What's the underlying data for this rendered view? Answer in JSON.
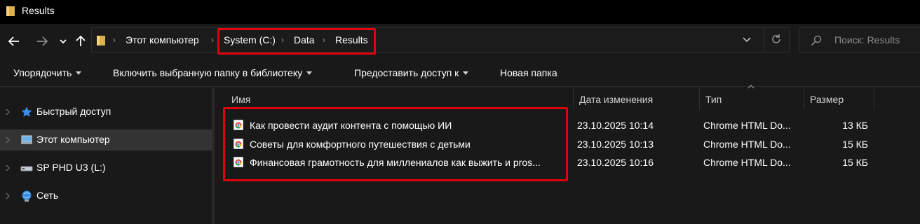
{
  "window": {
    "title": "Results"
  },
  "address": {
    "crumbs": [
      "Этот компьютер",
      "System (C:)",
      "Data",
      "Results"
    ]
  },
  "search": {
    "placeholder": "Поиск: Results"
  },
  "toolbar": {
    "organize": "Упорядочить",
    "include_in_library": "Включить выбранную папку в библиотеку",
    "share_with": "Предоставить доступ к",
    "new_folder": "Новая папка"
  },
  "sidebar": {
    "items": [
      {
        "label": "Быстрый доступ",
        "icon": "star-icon"
      },
      {
        "label": "Этот компьютер",
        "icon": "computer-icon",
        "selected": true
      },
      {
        "label": "SP PHD U3 (L:)",
        "icon": "drive-icon"
      },
      {
        "label": "Сеть",
        "icon": "network-icon"
      }
    ]
  },
  "columns": {
    "name": "Имя",
    "modified": "Дата изменения",
    "type": "Тип",
    "size": "Размер"
  },
  "files": [
    {
      "name": "Как провести аудит контента с помощью ИИ",
      "modified": "23.10.2025 10:14",
      "type": "Chrome HTML Do...",
      "size": "13 КБ",
      "icon": "chrome-html-icon"
    },
    {
      "name": "Советы для комфортного путешествия с детьми",
      "modified": "23.10.2025 10:13",
      "type": "Chrome HTML Do...",
      "size": "15 КБ",
      "icon": "chrome-html-icon"
    },
    {
      "name": "Финансовая грамотность для миллениалов как выжить и pros...",
      "modified": "23.10.2025 10:16",
      "type": "Chrome HTML Do...",
      "size": "15 КБ",
      "icon": "chrome-html-icon"
    }
  ],
  "colors": {
    "highlight": "#e0000e",
    "folder": "#e8c15a"
  }
}
